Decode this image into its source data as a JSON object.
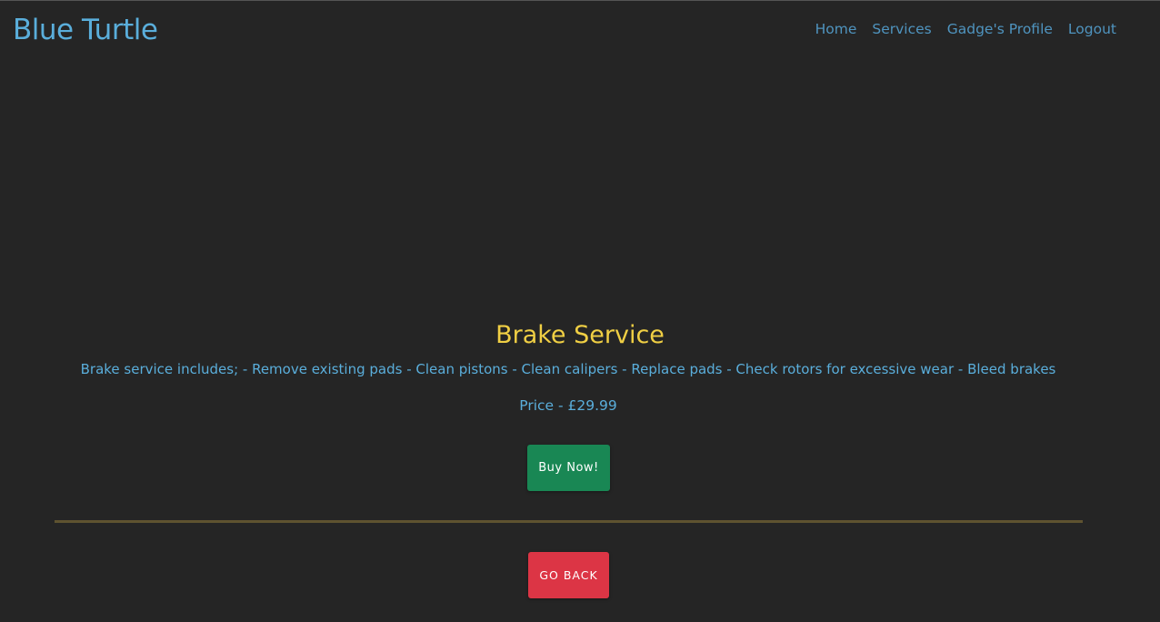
{
  "header": {
    "brand": "Blue Turtle",
    "nav": [
      {
        "label": "Home"
      },
      {
        "label": "Services"
      },
      {
        "label": "Gadge's Profile"
      },
      {
        "label": "Logout"
      }
    ]
  },
  "service": {
    "title": "Brake Service",
    "description": "Brake service includes; - Remove existing pads - Clean pistons - Clean calipers - Replace pads - Check rotors for excessive wear - Bleed brakes",
    "price": "Price - £29.99",
    "buy_label": "Buy Now!"
  },
  "footer": {
    "back_label": "GO BACK"
  },
  "colors": {
    "background": "#252525",
    "brand": "#5aaedb",
    "title": "#f0cf44",
    "buy_button": "#198754",
    "back_button": "#dc3545",
    "divider": "#5f5330"
  }
}
